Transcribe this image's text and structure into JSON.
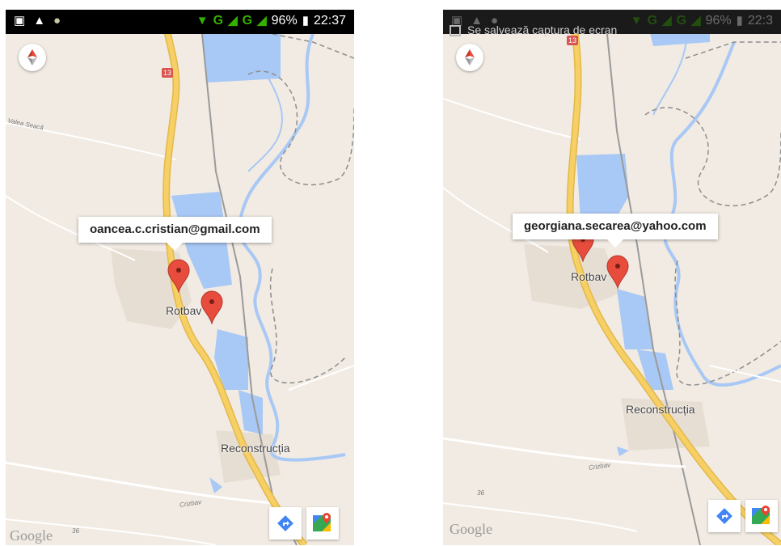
{
  "left": {
    "status": {
      "battery": "96%",
      "time": "22:37",
      "net1": "G",
      "net2": "G"
    },
    "tooltip": "oancea.c.cristian@gmail.com",
    "place_labels": [
      "Rotbav",
      "Reconstrucția"
    ],
    "road_labels": [
      "Valea Seacă",
      "Crizbav",
      "36"
    ],
    "road_shield": "13",
    "google": "Google"
  },
  "right": {
    "status": {
      "battery": "96%",
      "time": "22:3",
      "net1": "G",
      "net2": "G"
    },
    "notification": "Se salvează captura de ecran",
    "tooltip": "georgiana.secarea@yahoo.com",
    "place_labels": [
      "Rotbav",
      "Reconstrucția"
    ],
    "road_labels": [
      "Crizbav",
      "36"
    ],
    "road_shield": "13",
    "google": "Google"
  },
  "colors": {
    "land": "#f1ebe3",
    "water": "#a8c8f5",
    "road": "#f6cf65",
    "marker": "#e74c3c"
  }
}
